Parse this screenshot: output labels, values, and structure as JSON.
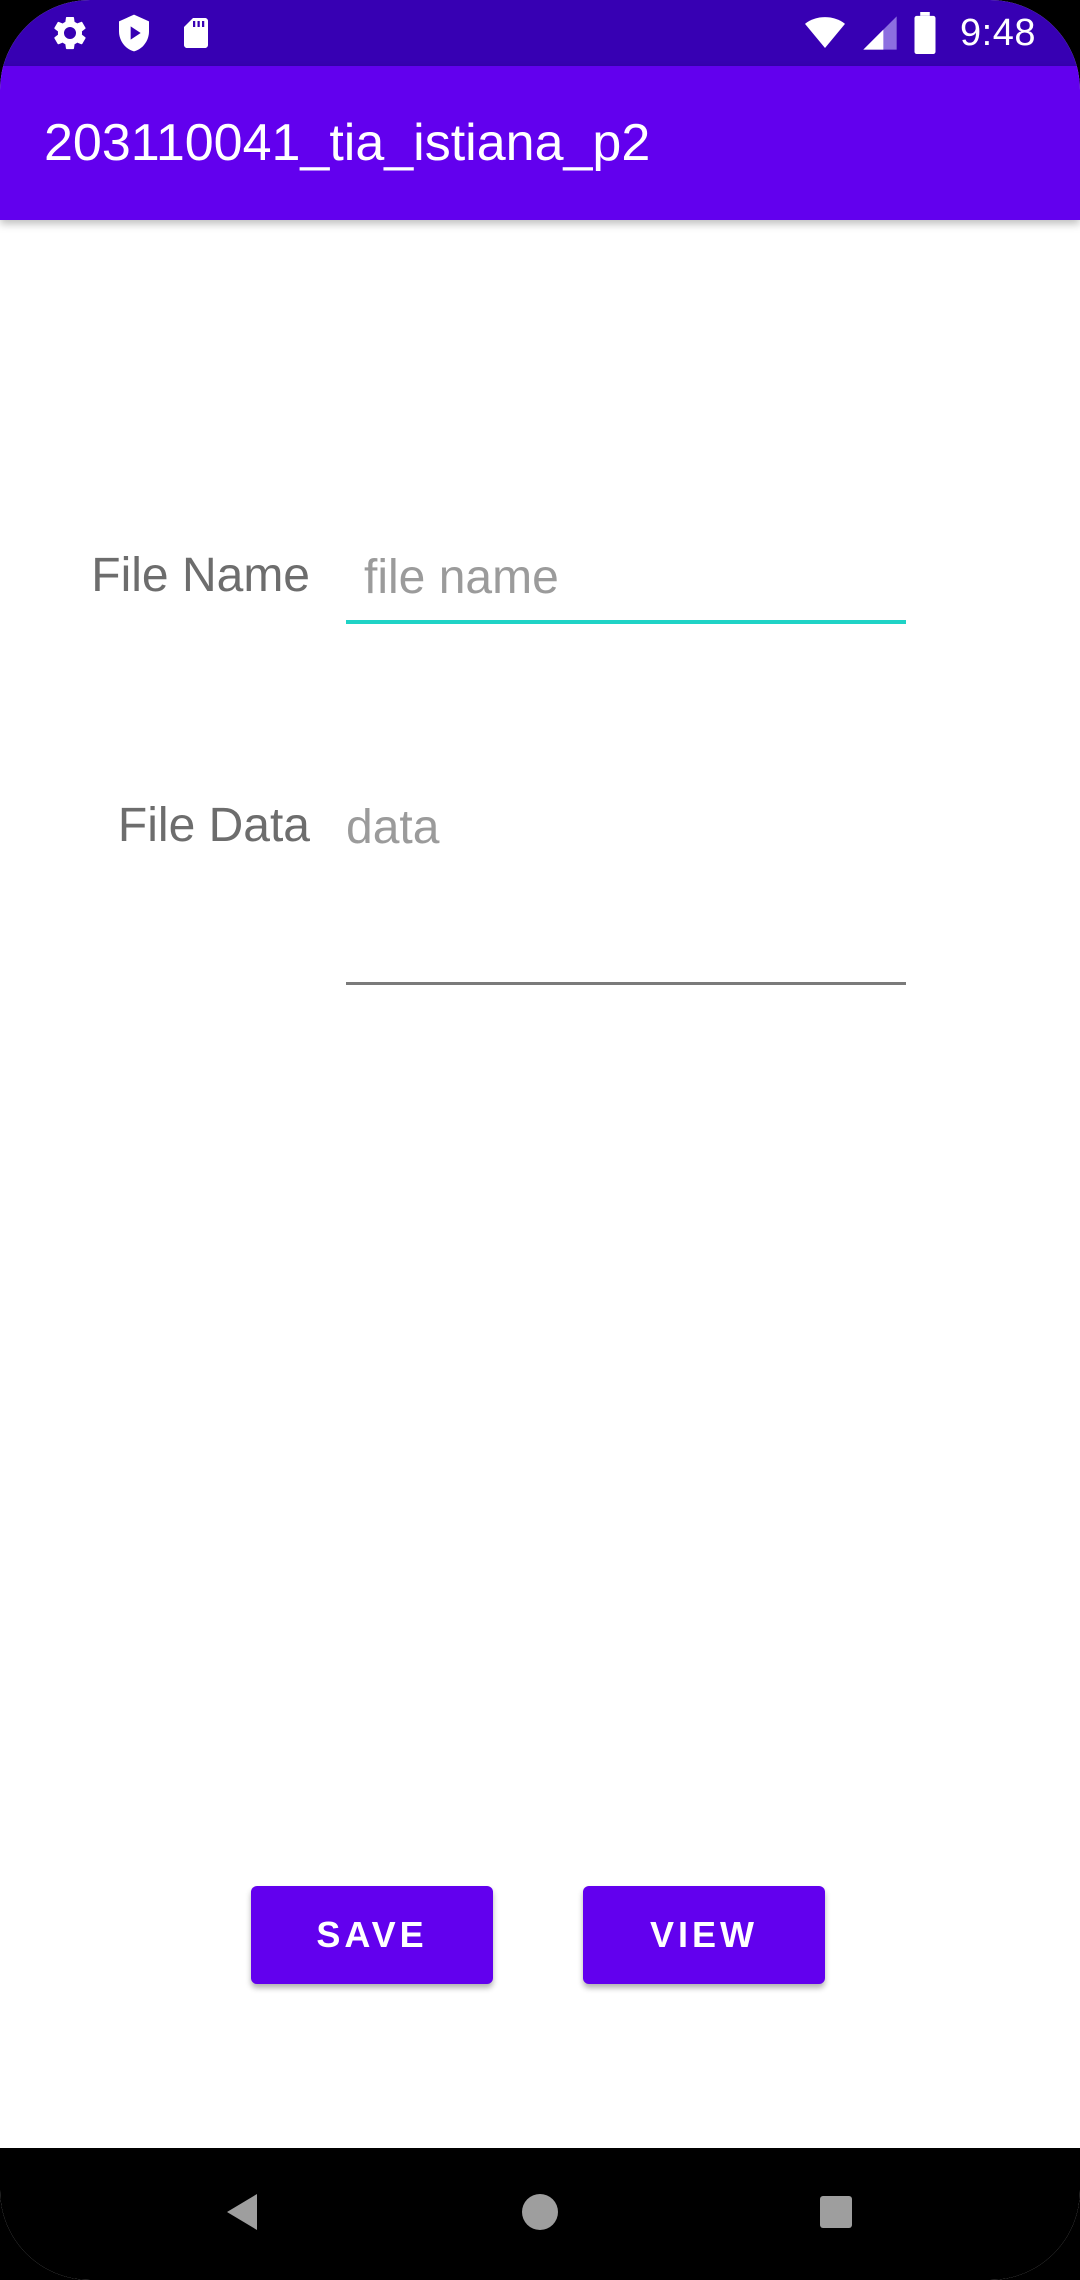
{
  "status_bar": {
    "time": "9:48",
    "left_icons": [
      "gear-icon",
      "shield-play-icon",
      "sd-card-icon"
    ],
    "right_icons": [
      "wifi-icon",
      "cell-signal-icon",
      "battery-icon"
    ]
  },
  "app_bar": {
    "title": "203110041_tia_istiana_p2"
  },
  "form": {
    "file_name_label": "File Name",
    "file_name_placeholder": "file name",
    "file_name_value": "",
    "file_data_label": "File Data",
    "file_data_placeholder": "data",
    "file_data_value": ""
  },
  "buttons": {
    "save_label": "SAVE",
    "view_label": "VIEW"
  },
  "nav_bar": {
    "icons": [
      "back-icon",
      "home-icon",
      "recents-icon"
    ]
  },
  "colors": {
    "status_bar": "#3700b3",
    "primary": "#6200ee",
    "accent_underline": "#1fd3c6"
  }
}
